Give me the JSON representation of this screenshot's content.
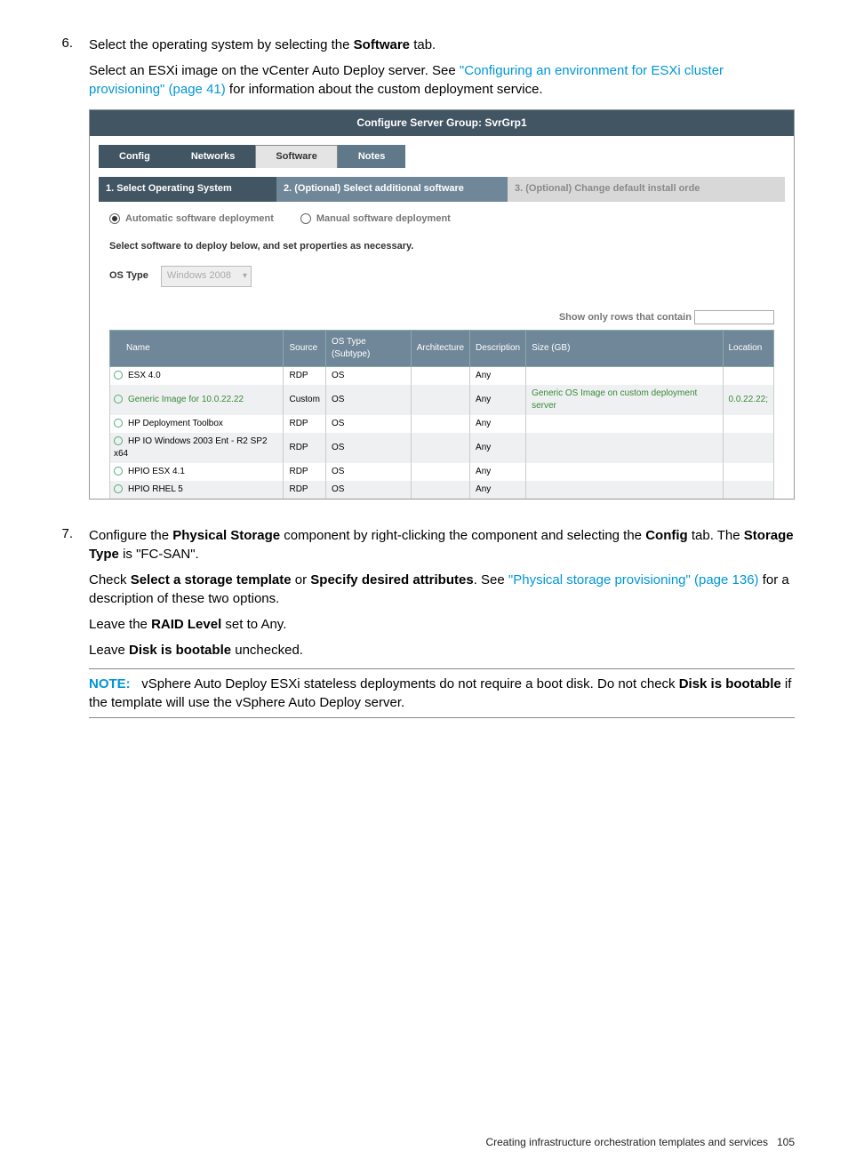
{
  "steps": {
    "s6_num": "6.",
    "s6_p1a": "Select the operating system by selecting the ",
    "s6_p1b": "Software",
    "s6_p1c": " tab.",
    "s6_p2a": "Select an ESXi image on the vCenter Auto Deploy server. See ",
    "s6_link": "\"Configuring an environment for ESXi cluster provisioning\" (page 41)",
    "s6_p2b": " for information about the custom deployment service.",
    "s7_num": "7.",
    "s7_p1a": "Configure the ",
    "s7_p1b": "Physical Storage",
    "s7_p1c": " component by right-clicking the component and selecting the ",
    "s7_p1d": "Config",
    "s7_p1e": " tab. The ",
    "s7_p1f": "Storage Type",
    "s7_p1g": " is \"FC-SAN\".",
    "s7_p2a": "Check ",
    "s7_p2b": "Select a storage template",
    "s7_p2c": " or ",
    "s7_p2d": "Specify desired attributes",
    "s7_p2e": ". See ",
    "s7_link": "\"Physical storage provisioning\" (page 136)",
    "s7_p2f": " for a description of these two options.",
    "s7_p3a": "Leave the ",
    "s7_p3b": "RAID Level",
    "s7_p3c": " set to Any.",
    "s7_p4a": "Leave ",
    "s7_p4b": "Disk is bootable",
    "s7_p4c": " unchecked."
  },
  "note": {
    "label": "NOTE:",
    "t1": "vSphere Auto Deploy ESXi stateless deployments do not require a boot disk. Do not check ",
    "b1": "Disk is bootable",
    "t2": " if the template will use the vSphere Auto Deploy server."
  },
  "shot": {
    "title": "Configure Server Group: SvrGrp1",
    "tabs": {
      "config": "Config",
      "networks": "Networks",
      "software": "Software",
      "notes": "Notes"
    },
    "segs": {
      "s1": "1. Select Operating System",
      "s2": "2. (Optional) Select additional software",
      "s3": "3. (Optional) Change default install orde"
    },
    "radios": {
      "auto": "Automatic software deployment",
      "manual": "Manual software deployment"
    },
    "instruct": "Select software to deploy below, and set properties as necessary.",
    "ostype_label": "OS Type",
    "ostype_value": "Windows 2008",
    "filter_label": "Show only rows that contain",
    "th": {
      "name": "Name",
      "source": "Source",
      "ostype": "OS Type (Subtype)",
      "arch": "Architecture",
      "desc": "Description",
      "size": "Size (GB)",
      "loc": "Location"
    },
    "rows": [
      {
        "name": "ESX 4.0",
        "source": "RDP",
        "ostype": "OS",
        "arch": "",
        "desc": "Any",
        "size": "",
        "loc": ""
      },
      {
        "name": "Generic Image for 10.0.22.22",
        "source": "Custom",
        "ostype": "OS",
        "arch": "",
        "desc": "Any",
        "size": "Generic OS Image on custom deployment server",
        "loc": "0.0.22.22;"
      },
      {
        "name": "HP Deployment Toolbox",
        "source": "RDP",
        "ostype": "OS",
        "arch": "",
        "desc": "Any",
        "size": "",
        "loc": ""
      },
      {
        "name": "HP IO Windows 2003 Ent - R2 SP2 x64",
        "source": "RDP",
        "ostype": "OS",
        "arch": "",
        "desc": "Any",
        "size": "",
        "loc": ""
      },
      {
        "name": "HPIO ESX 4.1",
        "source": "RDP",
        "ostype": "OS",
        "arch": "",
        "desc": "Any",
        "size": "",
        "loc": ""
      },
      {
        "name": "HPIO RHEL 5",
        "source": "RDP",
        "ostype": "OS",
        "arch": "",
        "desc": "Any",
        "size": "",
        "loc": ""
      }
    ]
  },
  "footer": {
    "text": "Creating infrastructure orchestration templates and services",
    "page": "105"
  }
}
